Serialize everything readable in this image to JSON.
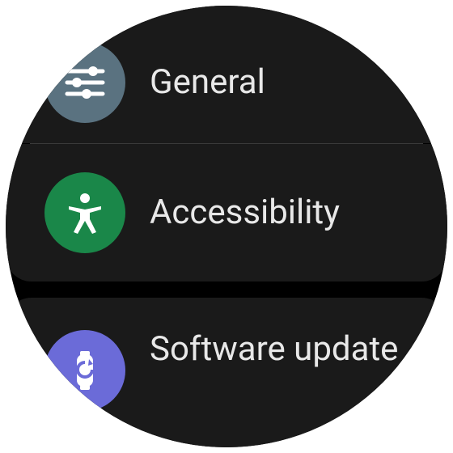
{
  "settings": {
    "items": [
      {
        "label": "General",
        "icon": "sliders-icon",
        "iconColor": "#5a7280"
      },
      {
        "label": "Accessibility",
        "icon": "accessibility-icon",
        "iconColor": "#1a8749"
      },
      {
        "label": "Software update",
        "icon": "software-update-icon",
        "iconColor": "#6b6bd8"
      }
    ]
  }
}
